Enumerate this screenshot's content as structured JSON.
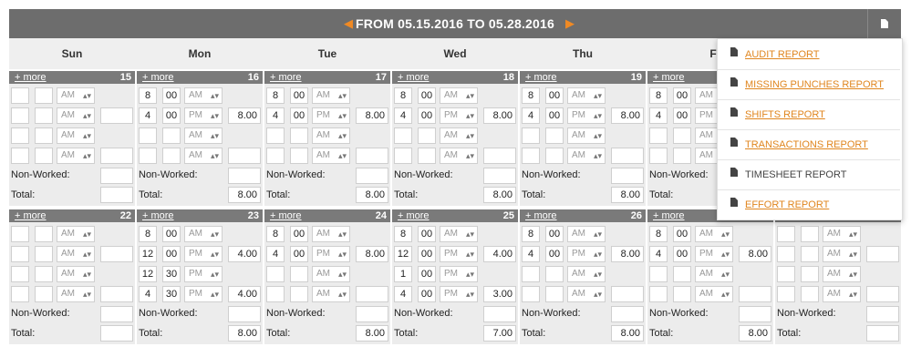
{
  "header": {
    "title": "FROM 05.15.2016 TO 05.28.2016",
    "prev_icon": "caret-left-icon",
    "next_icon": "caret-right-icon",
    "report_icon": "document-icon"
  },
  "day_names": [
    "Sun",
    "Mon",
    "Tue",
    "Wed",
    "Thu",
    "F",
    ""
  ],
  "labels": {
    "more": "+ more",
    "non_worked": "Non-Worked:",
    "total": "Total:",
    "ampm_default": "AM"
  },
  "week1": [
    {
      "day": "15",
      "total": "",
      "rows": [
        {
          "h": "",
          "m": "",
          "ap": "AM",
          "hrs": ""
        },
        {
          "h": "",
          "m": "",
          "ap": "AM",
          "hrs": ""
        },
        {
          "h": "",
          "m": "",
          "ap": "AM",
          "hrs": ""
        },
        {
          "h": "",
          "m": "",
          "ap": "AM",
          "hrs": ""
        }
      ]
    },
    {
      "day": "16",
      "total": "8.00",
      "rows": [
        {
          "h": "8",
          "m": "00",
          "ap": "AM",
          "hrs": ""
        },
        {
          "h": "4",
          "m": "00",
          "ap": "PM",
          "hrs": "8.00"
        },
        {
          "h": "",
          "m": "",
          "ap": "AM",
          "hrs": ""
        },
        {
          "h": "",
          "m": "",
          "ap": "AM",
          "hrs": ""
        }
      ]
    },
    {
      "day": "17",
      "total": "8.00",
      "rows": [
        {
          "h": "8",
          "m": "00",
          "ap": "AM",
          "hrs": ""
        },
        {
          "h": "4",
          "m": "00",
          "ap": "PM",
          "hrs": "8.00"
        },
        {
          "h": "",
          "m": "",
          "ap": "AM",
          "hrs": ""
        },
        {
          "h": "",
          "m": "",
          "ap": "AM",
          "hrs": ""
        }
      ]
    },
    {
      "day": "18",
      "total": "8.00",
      "rows": [
        {
          "h": "8",
          "m": "00",
          "ap": "AM",
          "hrs": ""
        },
        {
          "h": "4",
          "m": "00",
          "ap": "PM",
          "hrs": "8.00"
        },
        {
          "h": "",
          "m": "",
          "ap": "AM",
          "hrs": ""
        },
        {
          "h": "",
          "m": "",
          "ap": "AM",
          "hrs": ""
        }
      ]
    },
    {
      "day": "19",
      "total": "8.00",
      "rows": [
        {
          "h": "8",
          "m": "00",
          "ap": "AM",
          "hrs": ""
        },
        {
          "h": "4",
          "m": "00",
          "ap": "PM",
          "hrs": "8.00"
        },
        {
          "h": "",
          "m": "",
          "ap": "AM",
          "hrs": ""
        },
        {
          "h": "",
          "m": "",
          "ap": "AM",
          "hrs": ""
        }
      ]
    },
    {
      "day": "",
      "total": "",
      "rows": [
        {
          "h": "8",
          "m": "00",
          "ap": "AM",
          "hrs": ""
        },
        {
          "h": "4",
          "m": "00",
          "ap": "PM",
          "hrs": ""
        },
        {
          "h": "",
          "m": "",
          "ap": "AM",
          "hrs": ""
        },
        {
          "h": "",
          "m": "",
          "ap": "AM",
          "hrs": ""
        }
      ]
    }
  ],
  "week2": [
    {
      "day": "22",
      "total": "",
      "rows": [
        {
          "h": "",
          "m": "",
          "ap": "AM",
          "hrs": ""
        },
        {
          "h": "",
          "m": "",
          "ap": "AM",
          "hrs": ""
        },
        {
          "h": "",
          "m": "",
          "ap": "AM",
          "hrs": ""
        },
        {
          "h": "",
          "m": "",
          "ap": "AM",
          "hrs": ""
        }
      ]
    },
    {
      "day": "23",
      "total": "8.00",
      "rows": [
        {
          "h": "8",
          "m": "00",
          "ap": "AM",
          "hrs": ""
        },
        {
          "h": "12",
          "m": "00",
          "ap": "PM",
          "hrs": "4.00"
        },
        {
          "h": "12",
          "m": "30",
          "ap": "PM",
          "hrs": ""
        },
        {
          "h": "4",
          "m": "30",
          "ap": "PM",
          "hrs": "4.00"
        }
      ]
    },
    {
      "day": "24",
      "total": "8.00",
      "rows": [
        {
          "h": "8",
          "m": "00",
          "ap": "AM",
          "hrs": ""
        },
        {
          "h": "4",
          "m": "00",
          "ap": "PM",
          "hrs": "8.00"
        },
        {
          "h": "",
          "m": "",
          "ap": "AM",
          "hrs": ""
        },
        {
          "h": "",
          "m": "",
          "ap": "AM",
          "hrs": ""
        }
      ]
    },
    {
      "day": "25",
      "total": "7.00",
      "rows": [
        {
          "h": "8",
          "m": "00",
          "ap": "AM",
          "hrs": ""
        },
        {
          "h": "12",
          "m": "00",
          "ap": "PM",
          "hrs": "4.00"
        },
        {
          "h": "1",
          "m": "00",
          "ap": "PM",
          "hrs": ""
        },
        {
          "h": "4",
          "m": "00",
          "ap": "PM",
          "hrs": "3.00"
        }
      ]
    },
    {
      "day": "26",
      "total": "8.00",
      "rows": [
        {
          "h": "8",
          "m": "00",
          "ap": "AM",
          "hrs": ""
        },
        {
          "h": "4",
          "m": "00",
          "ap": "PM",
          "hrs": "8.00"
        },
        {
          "h": "",
          "m": "",
          "ap": "AM",
          "hrs": ""
        },
        {
          "h": "",
          "m": "",
          "ap": "AM",
          "hrs": ""
        }
      ]
    },
    {
      "day": "",
      "total": "8.00",
      "rows": [
        {
          "h": "8",
          "m": "00",
          "ap": "AM",
          "hrs": ""
        },
        {
          "h": "4",
          "m": "00",
          "ap": "PM",
          "hrs": "8.00"
        },
        {
          "h": "",
          "m": "",
          "ap": "AM",
          "hrs": ""
        },
        {
          "h": "",
          "m": "",
          "ap": "AM",
          "hrs": ""
        }
      ]
    },
    {
      "day": "",
      "total": "",
      "rows": [
        {
          "h": "",
          "m": "",
          "ap": "AM",
          "hrs": ""
        },
        {
          "h": "",
          "m": "",
          "ap": "AM",
          "hrs": ""
        },
        {
          "h": "",
          "m": "",
          "ap": "AM",
          "hrs": ""
        },
        {
          "h": "",
          "m": "",
          "ap": "AM",
          "hrs": ""
        }
      ]
    }
  ],
  "report_menu": {
    "items": [
      {
        "label": "AUDIT REPORT",
        "link": true
      },
      {
        "label": "MISSING PUNCHES REPORT",
        "link": true
      },
      {
        "label": "SHIFTS REPORT",
        "link": true
      },
      {
        "label": "TRANSACTIONS REPORT",
        "link": true
      },
      {
        "label": "TIMESHEET REPORT",
        "link": false
      },
      {
        "label": "EFFORT REPORT",
        "link": true
      }
    ]
  },
  "colors": {
    "header_bg": "#6d6d6d",
    "accent": "#f08a24",
    "cell_bg": "#ececec",
    "bar_bg": "#7a7a7a"
  }
}
